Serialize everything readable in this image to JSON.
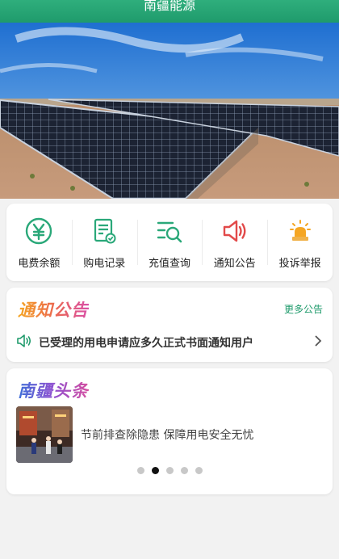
{
  "header": {
    "title": "南疆能源"
  },
  "menu": [
    {
      "label": "电费余额",
      "icon": "yuan-icon"
    },
    {
      "label": "购电记录",
      "icon": "record-icon"
    },
    {
      "label": "充值查询",
      "icon": "search-list-icon"
    },
    {
      "label": "通知公告",
      "icon": "speaker-icon"
    },
    {
      "label": "投诉举报",
      "icon": "alarm-icon"
    }
  ],
  "notice": {
    "title": "通知公告",
    "more": "更多公告",
    "item": "已受理的用电申请应多久正式书面通知用户"
  },
  "headlines": {
    "title": "南疆头条",
    "item": "节前排查除隐患 保障用电安全无忧",
    "carousel": {
      "total": 5,
      "active": 2
    }
  },
  "colors": {
    "brand": "#1f9b6c",
    "icon_green": "#2aa879",
    "icon_red": "#e24a4a",
    "icon_orange": "#f5a623"
  }
}
